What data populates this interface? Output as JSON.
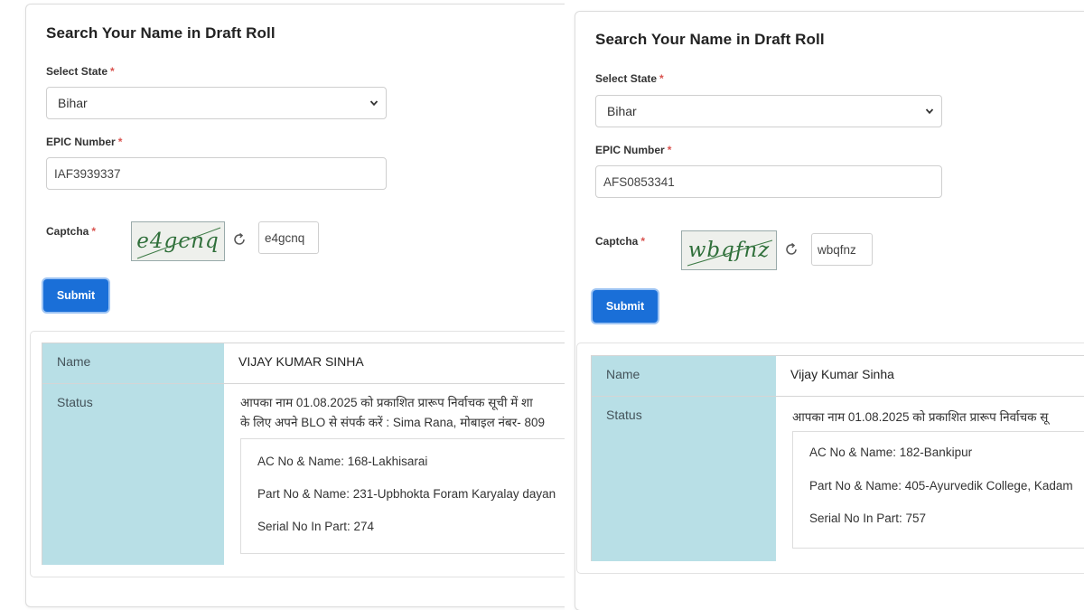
{
  "left": {
    "title": "Search Your Name in Draft Roll",
    "state_label": "Select State",
    "required_mark": "*",
    "state_value": "Bihar",
    "epic_label": "EPIC Number",
    "epic_value": "IAF3939337",
    "captcha_label": "Captcha",
    "captcha_image_text": "e4gcnq",
    "captcha_value": "e4gcnq",
    "submit_label": "Submit",
    "result": {
      "name_label": "Name",
      "name_value": "VIJAY KUMAR SINHA",
      "status_label": "Status",
      "status_line1": "आपका नाम 01.08.2025 को प्रकाशित प्रारूप निर्वाचक सूची में शा",
      "status_line2": "के लिए अपने BLO से संपर्क करें : Sima Rana, मोबाइल नंबर- 809",
      "ac": "AC No & Name: 168-Lakhisarai",
      "part": "Part No & Name: 231-Upbhokta Foram Karyalay dayan",
      "serial": "Serial No In Part: 274"
    }
  },
  "right": {
    "title": "Search Your Name in Draft Roll",
    "state_label": "Select State",
    "required_mark": "*",
    "state_value": "Bihar",
    "epic_label": "EPIC Number",
    "epic_value": "AFS0853341",
    "captcha_label": "Captcha",
    "captcha_image_text": "wbqfnz",
    "captcha_value": "wbqfnz",
    "submit_label": "Submit",
    "result": {
      "name_label": "Name",
      "name_value": "Vijay Kumar Sinha",
      "status_label": "Status",
      "status_line1": "आपका नाम 01.08.2025 को प्रकाशित प्रारूप निर्वाचक सू",
      "ac": "AC No & Name: 182-Bankipur",
      "part": "Part No & Name: 405-Ayurvedik College, Kadam",
      "serial": "Serial No In Part: 757"
    }
  },
  "colors": {
    "accent": "#1a6fd8",
    "label_cell": "#b8dfe6",
    "required": "#d9534f"
  },
  "icons": [
    "chevron-down-icon",
    "refresh-icon"
  ]
}
